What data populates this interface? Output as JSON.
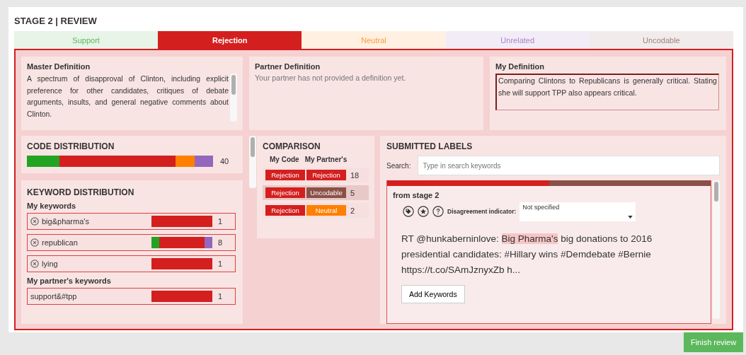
{
  "title": "STAGE 2 | REVIEW",
  "tabs": [
    {
      "label": "Support",
      "selected": false,
      "color": "#5cb85c"
    },
    {
      "label": "Rejection",
      "selected": true,
      "color": "#d41f1f"
    },
    {
      "label": "Neutral",
      "selected": false,
      "color": "#ff9a3c"
    },
    {
      "label": "Unrelated",
      "selected": false,
      "color": "#a982c9"
    },
    {
      "label": "Uncodable",
      "selected": false,
      "color": "#a08078"
    }
  ],
  "definitions": [
    {
      "kind": "text",
      "title": "Master Definition",
      "text": "A spectrum of disapproval of Clinton, including explicit preference for other candidates, critiques of debate arguments, insults, and general negative comments about Clinton."
    },
    {
      "kind": "empty",
      "title": "Partner Definition",
      "text": "Your partner has not provided a definition yet."
    },
    {
      "kind": "input",
      "title": "My Definition",
      "text": "Comparing Clintons to Republicans is generally critical. Stating she will support TPP also appears critical."
    }
  ],
  "code_distribution": {
    "title": "CODE DISTRIBUTION",
    "count": "40",
    "segments": [
      {
        "color": "#22a322"
      },
      {
        "color": "#d41f1f"
      },
      {
        "color": "#ff7f00"
      },
      {
        "color": "#9467bd"
      }
    ]
  },
  "keyword_distribution": {
    "title": "KEYWORD DISTRIBUTION",
    "groups": [
      {
        "heading": "My keywords",
        "removable": true,
        "keywords": [
          {
            "label": "big&pharma's",
            "count": "1",
            "segments": [
              {
                "color": "#d41f1f"
              }
            ]
          },
          {
            "label": "republican",
            "count": "8",
            "segments": [
              {
                "color": "#22a322"
              },
              {
                "color": "#d41f1f"
              },
              {
                "color": "#9467bd"
              }
            ]
          },
          {
            "label": "lying",
            "count": "1",
            "segments": [
              {
                "color": "#d41f1f"
              }
            ]
          }
        ]
      },
      {
        "heading": "My partner's keywords",
        "removable": false,
        "keywords": [
          {
            "label": "support&#tpp",
            "count": "1",
            "segments": [
              {
                "color": "#d41f1f"
              }
            ]
          }
        ]
      }
    ]
  },
  "comparison": {
    "title": "COMPARISON",
    "columns": [
      "My Code",
      "My Partner's"
    ],
    "rows": [
      {
        "mine": {
          "label": "Rejection",
          "color": "#d41f1f"
        },
        "partner": {
          "label": "Rejection",
          "color": "#d41f1f"
        },
        "count": "18",
        "selected": false
      },
      {
        "mine": {
          "label": "Rejection",
          "color": "#d41f1f"
        },
        "partner": {
          "label": "Uncodable",
          "color": "#8b5148"
        },
        "count": "5",
        "selected": true
      },
      {
        "mine": {
          "label": "Rejection",
          "color": "#d41f1f"
        },
        "partner": {
          "label": "Neutral",
          "color": "#ff7f00"
        },
        "count": "2",
        "selected": false
      }
    ]
  },
  "submitted_labels": {
    "title": "SUBMITTED LABELS",
    "search_label": "Search:",
    "search_placeholder": "Type in search keywords",
    "card": {
      "segments": [
        {
          "color": "#d41f1f"
        },
        {
          "color": "#8b5148"
        }
      ],
      "source": "from stage 2",
      "indicator_label": "Disagreement indicator:",
      "indicator_value": "Not specified",
      "text_before": "RT @hunkaberninlove: ",
      "highlight": "Big Pharma's",
      "text_after": " big donations to 2016 presidential candidates: #Hillary wins #Demdebate #Bernie https://t.co/SAmJznyxZb h...",
      "button": "Add Keywords"
    }
  },
  "finish_button": "Finish review"
}
